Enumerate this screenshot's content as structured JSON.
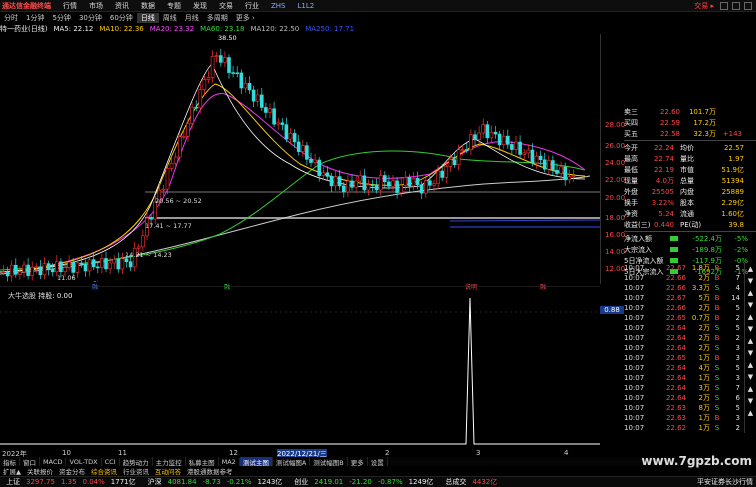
{
  "menubar": {
    "logo": "通达信金融终端",
    "items": [
      "行情",
      "市场",
      "资讯",
      "数据",
      "专题",
      "发现",
      "交易",
      "行业",
      "ZHS",
      "L1L2"
    ],
    "trade": "交易 ▸"
  },
  "periods": [
    "分时",
    "1分钟",
    "5分钟",
    "30分钟",
    "60分钟",
    "日线",
    "周线",
    "月线",
    "多周期",
    "更多 ›"
  ],
  "periods_active_index": 5,
  "stock": {
    "name": "特一药业(日线)",
    "ma5": "MA5: 22.12",
    "ma10": "MA10: 22.36",
    "ma20": "MA20: 23.32",
    "ma60": "MA60: 23.18",
    "ma120": "MA120: 22.50",
    "ma250": "MA250: 17.71"
  },
  "chart_annotations": {
    "high": "38.50",
    "range1": "20.56 ~ 20.52",
    "range2": "17.41 ~ 17.77",
    "range3": "14.21 ~ 14.23",
    "low": "11.06"
  },
  "price_axis": [
    "28.00",
    "26.00",
    "24.00",
    "22.00",
    "20.00",
    "18.00",
    "16.00",
    "14.00",
    "12.00"
  ],
  "event_tags": [
    "融",
    "融",
    "说明",
    "融"
  ],
  "right_panel": {
    "asks": [
      {
        "label": "卖三",
        "price": "22.60",
        "vol": "101.7万",
        "extra": ""
      },
      {
        "label": "买四",
        "price": "22.59",
        "vol": "17.2万",
        "extra": ""
      },
      {
        "label": "买五",
        "price": "22.58",
        "vol": "32.3万",
        "extra": "+143"
      }
    ],
    "stats": [
      {
        "l1": "今开",
        "v1": "22.24",
        "l2": "均价",
        "v2": "22.57"
      },
      {
        "l1": "最高",
        "v1": "22.74",
        "l2": "量比",
        "v2": "1.97"
      },
      {
        "l1": "最低",
        "v1": "22.19",
        "l2": "市值",
        "v2": "51.9亿"
      },
      {
        "l1": "现量",
        "v1": "4.0万",
        "l2": "总量",
        "v2": "51394"
      },
      {
        "l1": "外盘",
        "v1": "25505",
        "l2": "内盘",
        "v2": "25889"
      },
      {
        "l1": "换手",
        "v1": "3.22%",
        "l2": "股本",
        "v2": "2.29亿"
      },
      {
        "l1": "净资",
        "v1": "5.24",
        "l2": "流通",
        "v2": "1.60亿"
      },
      {
        "l1": "收益(三)",
        "v1": "0.440",
        "l2": "PE(动)",
        "v2": "39.8"
      }
    ],
    "flows": [
      {
        "label": "净流入额",
        "value": "-522.4万",
        "pct": "-5%"
      },
      {
        "label": "大宗流入",
        "value": "-189.8万",
        "pct": "-2%"
      },
      {
        "label": "5日净流入额",
        "value": "-117.9万",
        "pct": "-0%"
      },
      {
        "label": "5日大宗流入",
        "value": "-1692万",
        "pct": "-1%"
      }
    ]
  },
  "trades": [
    {
      "t": "10:07",
      "p": "22.67",
      "v": "1.8万",
      "s": "B",
      "n": "5"
    },
    {
      "t": "10:07",
      "p": "22.66",
      "v": "2万",
      "s": "B",
      "n": "7"
    },
    {
      "t": "10:07",
      "p": "22.66",
      "v": "3.3万",
      "s": "S",
      "n": "4"
    },
    {
      "t": "10:07",
      "p": "22.67",
      "v": "5万",
      "s": "B",
      "n": "14"
    },
    {
      "t": "10:07",
      "p": "22.66",
      "v": "2万",
      "s": "B",
      "n": "5"
    },
    {
      "t": "10:07",
      "p": "22.65",
      "v": "0.7万",
      "s": "B",
      "n": "2"
    },
    {
      "t": "10:07",
      "p": "22.64",
      "v": "2万",
      "s": "S",
      "n": "5"
    },
    {
      "t": "10:07",
      "p": "22.64",
      "v": "2万",
      "s": "B",
      "n": "2"
    },
    {
      "t": "10:07",
      "p": "22.64",
      "v": "2万",
      "s": "S",
      "n": "3"
    },
    {
      "t": "10:07",
      "p": "22.65",
      "v": "1万",
      "s": "B",
      "n": "3"
    },
    {
      "t": "10:07",
      "p": "22.64",
      "v": "4万",
      "s": "S",
      "n": "5"
    },
    {
      "t": "10:07",
      "p": "22.64",
      "v": "1万",
      "s": "S",
      "n": "3"
    },
    {
      "t": "10:07",
      "p": "22.64",
      "v": "3万",
      "s": "S",
      "n": "7"
    },
    {
      "t": "10:07",
      "p": "22.64",
      "v": "2万",
      "s": "S",
      "n": "6"
    },
    {
      "t": "10:07",
      "p": "22.63",
      "v": "8万",
      "s": "S",
      "n": "5"
    },
    {
      "t": "10:07",
      "p": "22.63",
      "v": "1万",
      "s": "B",
      "n": "3"
    },
    {
      "t": "10:07",
      "p": "22.62",
      "v": "1万",
      "s": "S",
      "n": "2"
    }
  ],
  "indicator": {
    "title": "大牛选股",
    "sub": "持股: 0.00",
    "value": "0.88"
  },
  "time_axis": [
    "2022年",
    "10",
    "11",
    "12",
    "2022/12/21/三",
    "2",
    "3",
    "4"
  ],
  "tabs": [
    "指标",
    "窗口",
    "MACD",
    "VOL-TDX",
    "CCI",
    "趋势动力",
    "主力监控",
    "私募主图",
    "MA2",
    "测试主图",
    "测试幅图A",
    "测试幅图B",
    "更多",
    "设置"
  ],
  "tabs_highlight_index": 9,
  "funcbar": [
    "扩展▲",
    "关联报价",
    "资金分布",
    "综合资讯",
    "行业资讯",
    "互动问答",
    "港股通数据参考"
  ],
  "funcbar_em": [
    3,
    5
  ],
  "statusbar": [
    {
      "name": "上证",
      "val": "3297.75",
      "chg": "1.35",
      "pct": "0.04%",
      "amt": "1771亿"
    },
    {
      "name": "沪深",
      "val": "4081.84",
      "chg": "-8.73",
      "pct": "-0.21%",
      "amt": "1243亿"
    },
    {
      "name": "创业",
      "val": "2419.01",
      "chg": "-21.20",
      "pct": "-0.87%",
      "amt": "1249亿"
    },
    {
      "name": "总成交",
      "val": "4432亿",
      "chg": "",
      "pct": "",
      "amt": ""
    }
  ],
  "status_tail": "平安证券长沙行情",
  "watermark": "www.7gpzb.com"
}
